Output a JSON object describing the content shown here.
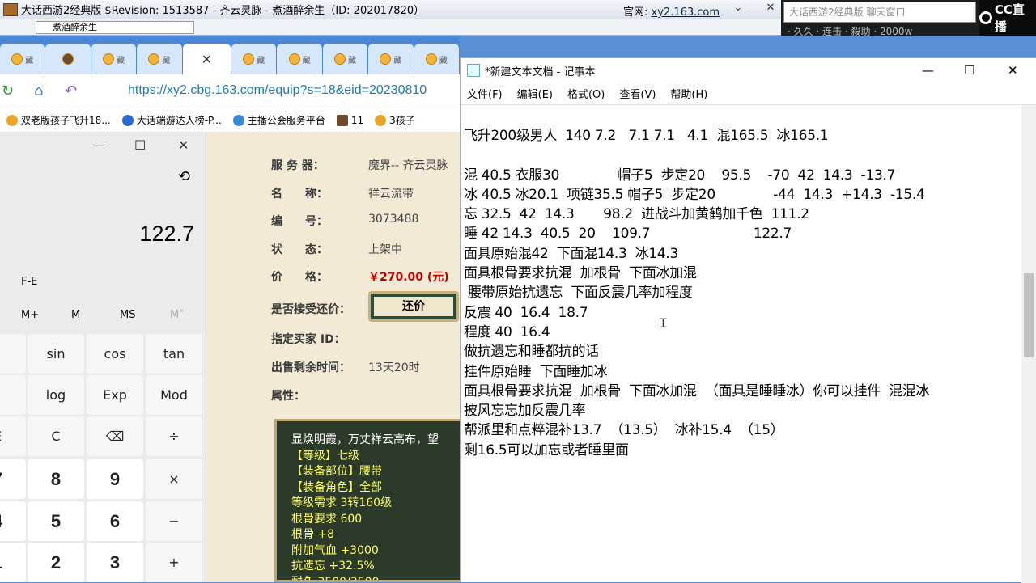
{
  "game_window": {
    "title": "大话西游2经典版 $Revision: 1513587 - 齐云灵脉 - 煮酒醉余生（ID: 202017820）",
    "site_label": "官网:",
    "site_url": "xy2.163.com",
    "char_select": "煮酒醉余生",
    "chat_placeholder": "大话西游2经典版 聊天窗口",
    "ticker": "· 久久 · 连击 · 殺助 · 2000w"
  },
  "cc_logo": "CC直播",
  "browser": {
    "url": "https://xy2.cbg.163.com/equip?s=18&eid=20230810",
    "bookmarks": [
      "双老版孩子飞升18...",
      "大话端游达人榜-P...",
      "主播公会服务平台",
      "11",
      "3孩子"
    ]
  },
  "cbg": {
    "fields": [
      {
        "label": "服 务 器：",
        "value": "魔界-- 齐云灵脉"
      },
      {
        "label": "名　　称：",
        "value": "祥云流带"
      },
      {
        "label": "编　　号：",
        "value": "3073488"
      },
      {
        "label": "状　　态：",
        "value": "上架中"
      },
      {
        "label": "价　　格：",
        "value": "￥270.00 (元)"
      },
      {
        "label": "是否接受还价：",
        "value": ""
      },
      {
        "label": "指定买家 ID：",
        "value": ""
      },
      {
        "label": "出售剩余时间：",
        "value": "13天20时"
      },
      {
        "label": "属性：",
        "value": ""
      }
    ],
    "counter_offer_button": "还价",
    "item_desc": "显焕明霞，万丈祥云高布，望",
    "item_props": [
      "【等级】七级",
      "【装备部位】腰带",
      "【装备角色】全部",
      "等级需求 3转160级",
      "根骨要求 600",
      "根骨 +8",
      "附加气血 +3000",
      "抗遗忘 +32.5%",
      "耐久 3500/3500"
    ]
  },
  "calculator": {
    "display": "122.7",
    "fe_label": "F-E",
    "memory": [
      "M+",
      "M-",
      "MS",
      "M˅"
    ],
    "keys": [
      {
        "label": "ʸ",
        "kind": "fn"
      },
      {
        "label": "sin",
        "kind": "fn"
      },
      {
        "label": "cos",
        "kind": "fn"
      },
      {
        "label": "tan",
        "kind": "fn"
      },
      {
        "label": "ˣ",
        "kind": "fn"
      },
      {
        "label": "log",
        "kind": "fn"
      },
      {
        "label": "Exp",
        "kind": "fn"
      },
      {
        "label": "Mod",
        "kind": "fn"
      },
      {
        "label": "E",
        "kind": "fn"
      },
      {
        "label": "C",
        "kind": "fn"
      },
      {
        "label": "⌫",
        "kind": "fn"
      },
      {
        "label": "÷",
        "kind": "fn"
      },
      {
        "label": "7",
        "kind": "num"
      },
      {
        "label": "8",
        "kind": "num"
      },
      {
        "label": "9",
        "kind": "num"
      },
      {
        "label": "×",
        "kind": "fn"
      },
      {
        "label": "4",
        "kind": "num"
      },
      {
        "label": "5",
        "kind": "num"
      },
      {
        "label": "6",
        "kind": "num"
      },
      {
        "label": "−",
        "kind": "fn"
      },
      {
        "label": "1",
        "kind": "num"
      },
      {
        "label": "2",
        "kind": "num"
      },
      {
        "label": "3",
        "kind": "num"
      },
      {
        "label": "+",
        "kind": "fn"
      }
    ]
  },
  "notepad": {
    "title": "*新建文本文档 - 记事本",
    "menu": [
      "文件(F)",
      "编辑(E)",
      "格式(O)",
      "查看(V)",
      "帮助(H)"
    ],
    "lines": [
      "飞升200级男人  140 7.2   7.1 7.1   4.1  混165.5  冰165.1",
      "",
      "混 40.5 衣服30              帽子5  步定20    95.5    -70  42  14.3  -13.7",
      "冰 40.5 冰20.1  项链35.5 帽子5  步定20              -44  14.3  +14.3  -15.4",
      "忘 32.5  42  14.3       98.2  进战斗加黄鹤加千色  111.2",
      "睡 42 14.3  40.5  20    109.7                         122.7",
      "面具原始混42  下面混14.3  冰14.3",
      "面具根骨要求抗混  加根骨  下面冰加混",
      " 腰带原始抗遗忘  下面反震几率加程度",
      "反震 40  16.4  18.7",
      "程度 40  16.4",
      "做抗遗忘和睡都抗的话",
      "挂件原始睡  下面睡加冰",
      "面具根骨要求抗混  加根骨  下面冰加混  （面具是睡睡冰）你可以挂件  混混冰",
      "披风忘忘加反震几率",
      "帮派里和点粹混补13.7  （13.5）  冰补15.4  （15）",
      "剩16.5可以加忘或者睡里面"
    ]
  }
}
